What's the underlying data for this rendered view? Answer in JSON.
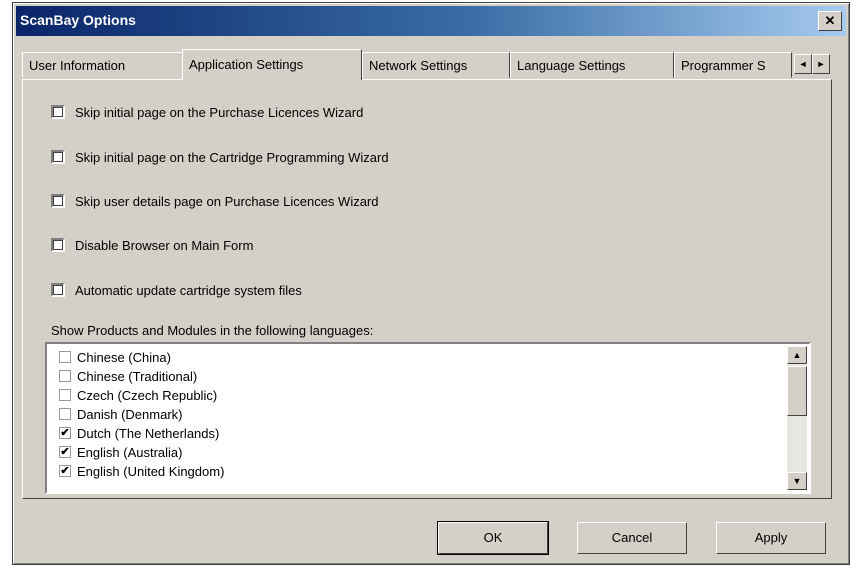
{
  "window": {
    "title": "ScanBay Options",
    "close_glyph": "✕"
  },
  "tabs": [
    {
      "label": "User Information"
    },
    {
      "label": "Application Settings"
    },
    {
      "label": "Network Settings"
    },
    {
      "label": "Language Settings"
    },
    {
      "label": "Programmer S"
    }
  ],
  "tab_scroll": {
    "left_glyph": "◄",
    "right_glyph": "►"
  },
  "options": [
    {
      "label": "Skip initial page on the Purchase Licences Wizard",
      "checked": false
    },
    {
      "label": "Skip initial page on the Cartridge Programming Wizard",
      "checked": false
    },
    {
      "label": "Skip user details page on Purchase Licences Wizard",
      "checked": false
    },
    {
      "label": "Disable Browser on Main Form",
      "checked": false
    },
    {
      "label": "Automatic update cartridge system files",
      "checked": false
    }
  ],
  "languages_label": "Show Products and Modules in the following languages:",
  "languages": [
    {
      "label": "Chinese (China)",
      "checked": false,
      "mark": ""
    },
    {
      "label": "Chinese (Traditional)",
      "checked": false,
      "mark": ""
    },
    {
      "label": "Czech (Czech Republic)",
      "checked": false,
      "mark": ""
    },
    {
      "label": "Danish (Denmark)",
      "checked": false,
      "mark": ""
    },
    {
      "label": "Dutch (The Netherlands)",
      "checked": true,
      "mark": "✔"
    },
    {
      "label": "English (Australia)",
      "checked": true,
      "mark": "✔"
    },
    {
      "label": "English (United Kingdom)",
      "checked": true,
      "mark": "✔"
    }
  ],
  "scrollbar": {
    "up_glyph": "▲",
    "down_glyph": "▼"
  },
  "buttons": {
    "ok": "OK",
    "cancel": "Cancel",
    "apply": "Apply"
  }
}
